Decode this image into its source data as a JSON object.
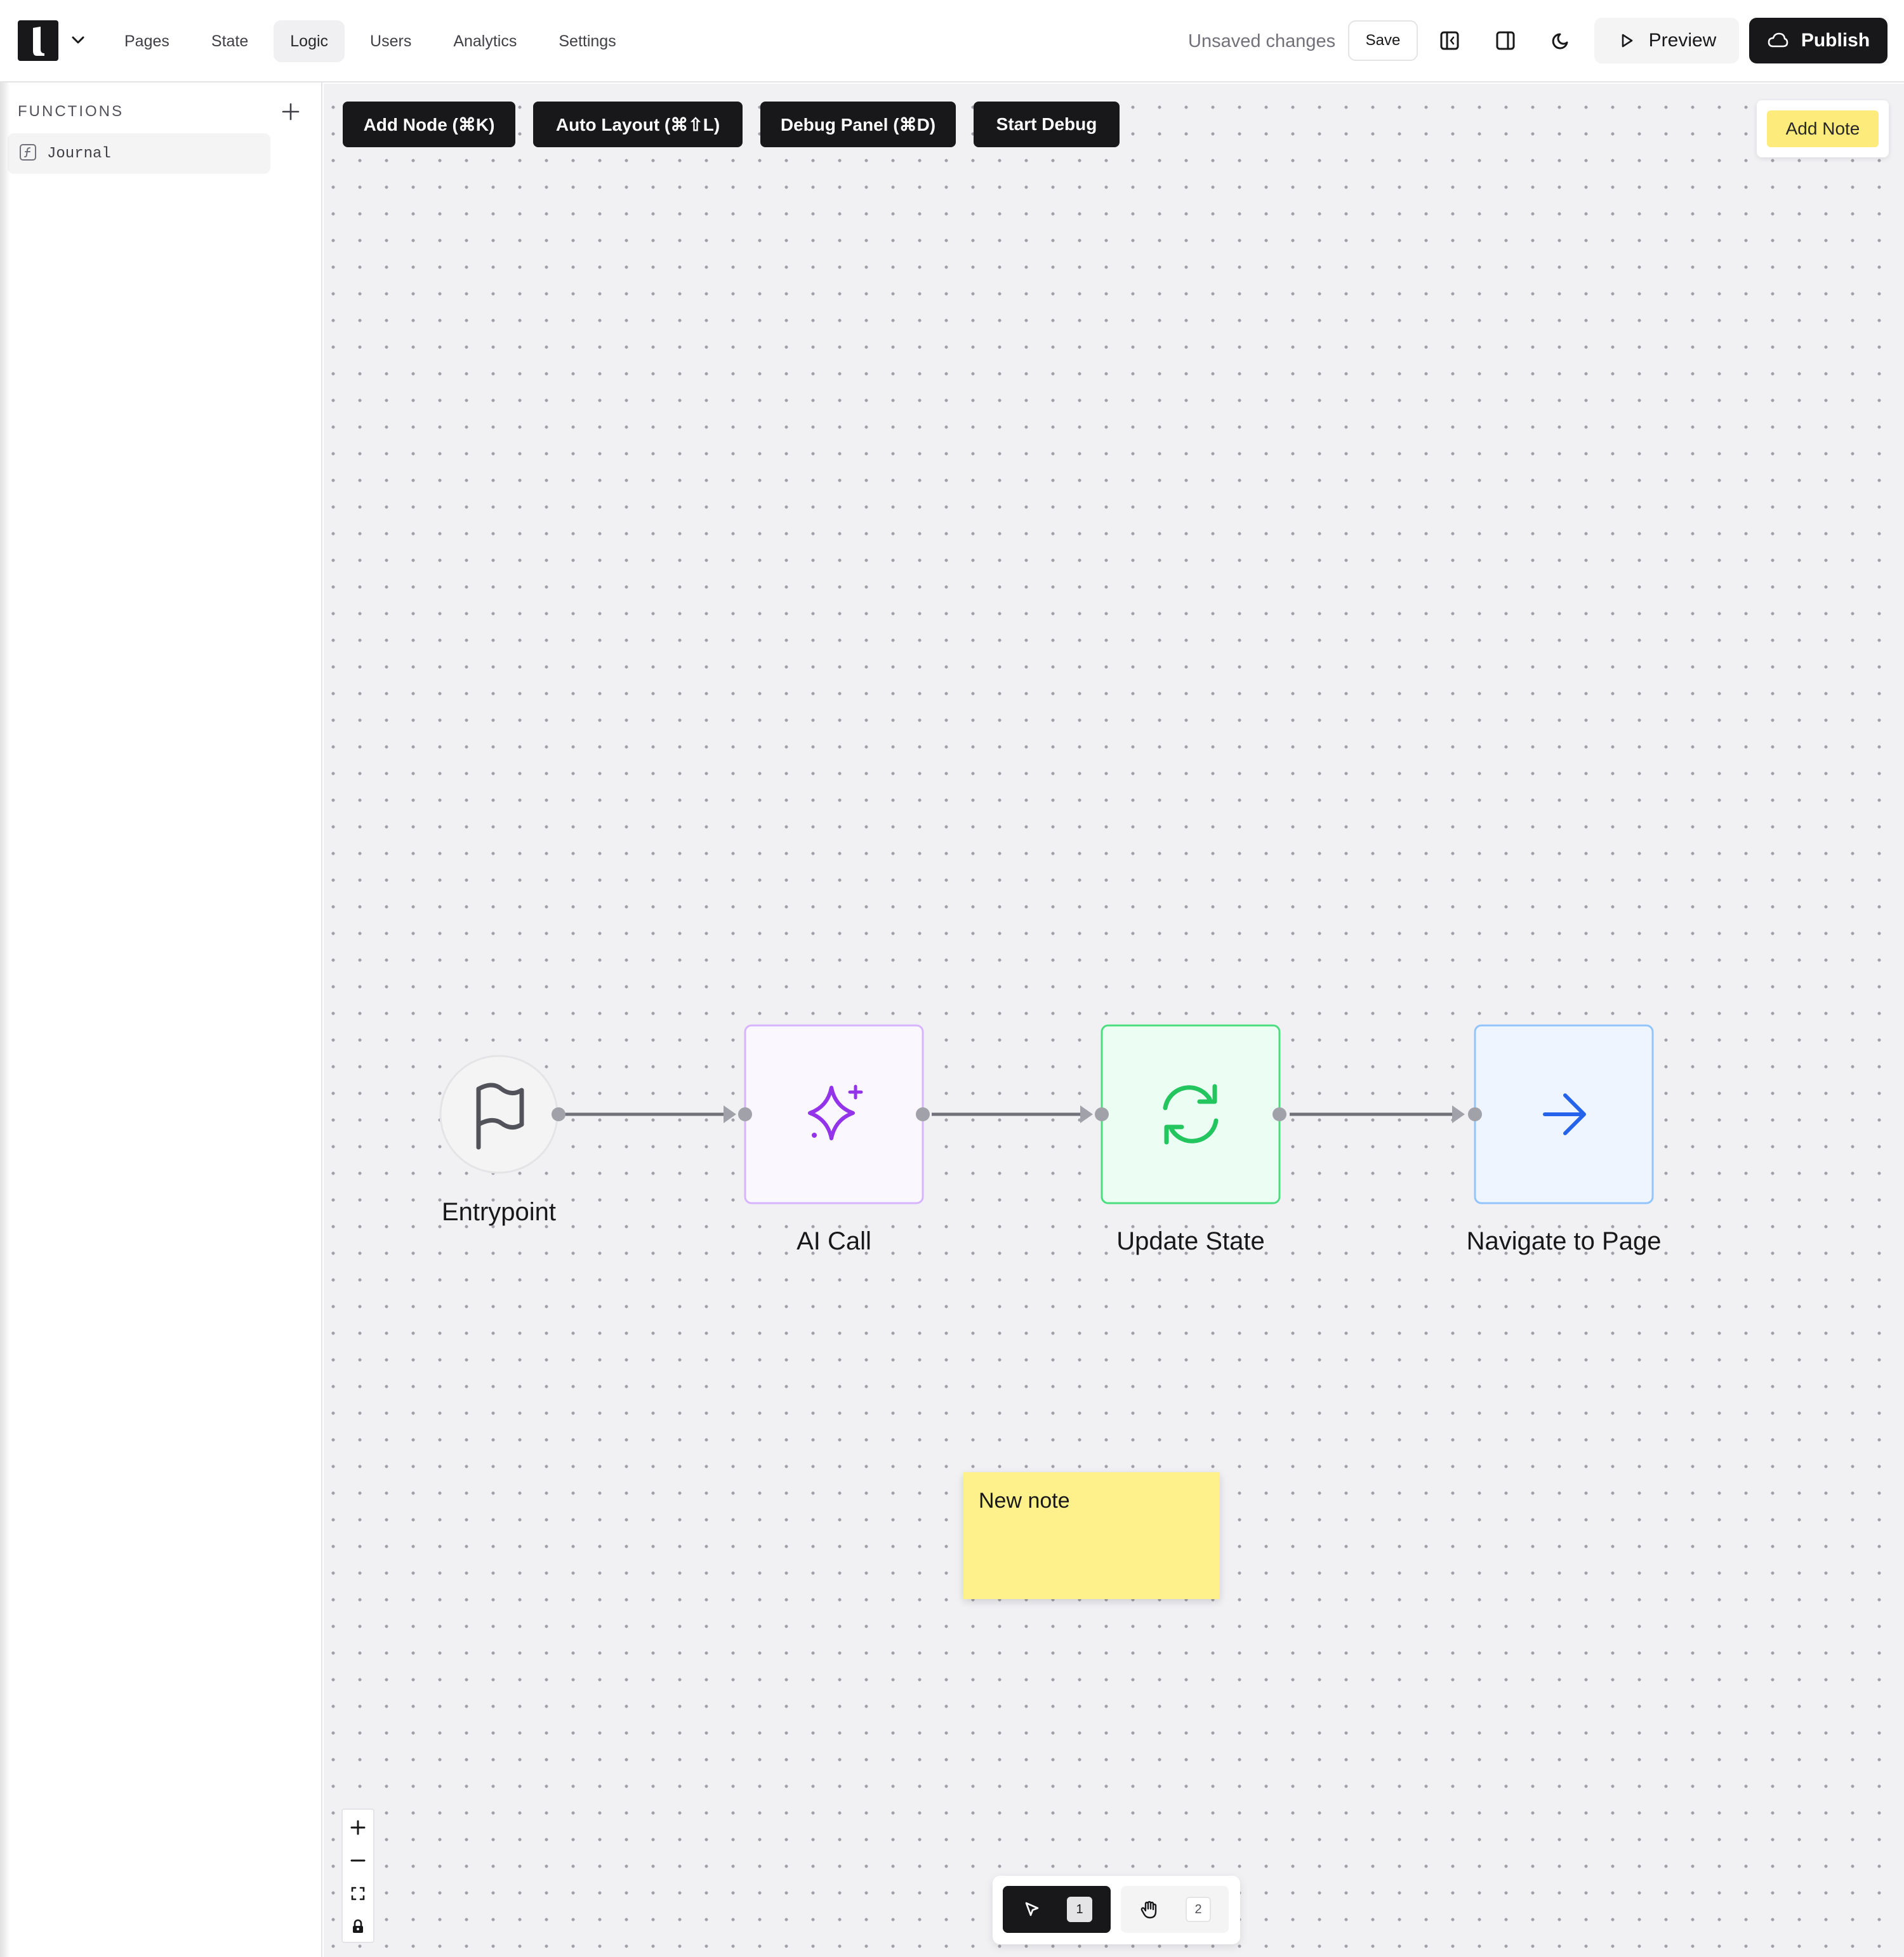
{
  "nav": {
    "items": [
      {
        "label": "Pages"
      },
      {
        "label": "State"
      },
      {
        "label": "Logic"
      },
      {
        "label": "Users"
      },
      {
        "label": "Analytics"
      },
      {
        "label": "Settings"
      }
    ],
    "active": "Logic"
  },
  "header": {
    "status": "Unsaved changes",
    "save_label": "Save",
    "preview_label": "Preview",
    "publish_label": "Publish"
  },
  "sidebar": {
    "title": "FUNCTIONS",
    "items": [
      {
        "label": "Journal",
        "icon": "function-icon"
      }
    ]
  },
  "canvas_toolbar": {
    "add_node": "Add Node (⌘K)",
    "auto_layout": "Auto Layout (⌘⇧L)",
    "debug_panel": "Debug Panel (⌘D)",
    "start_debug": "Start Debug",
    "add_note": "Add Note"
  },
  "flow": {
    "nodes": [
      {
        "label": "Entrypoint",
        "icon": "flag-icon"
      },
      {
        "label": "AI Call",
        "icon": "sparkles-icon",
        "color": "#9333ea"
      },
      {
        "label": "Update State",
        "icon": "refresh-icon",
        "color": "#22c55e"
      },
      {
        "label": "Navigate to Page",
        "icon": "arrow-right-icon",
        "color": "#2563eb"
      }
    ]
  },
  "note": {
    "text": "New note"
  },
  "modes": {
    "select": {
      "icon": "pointer-icon",
      "key": "1"
    },
    "hand": {
      "icon": "hand-icon",
      "key": "2"
    }
  },
  "colors": {
    "primary": "#18181b",
    "note": "#fef08a",
    "canvas": "#f1f1f4"
  }
}
